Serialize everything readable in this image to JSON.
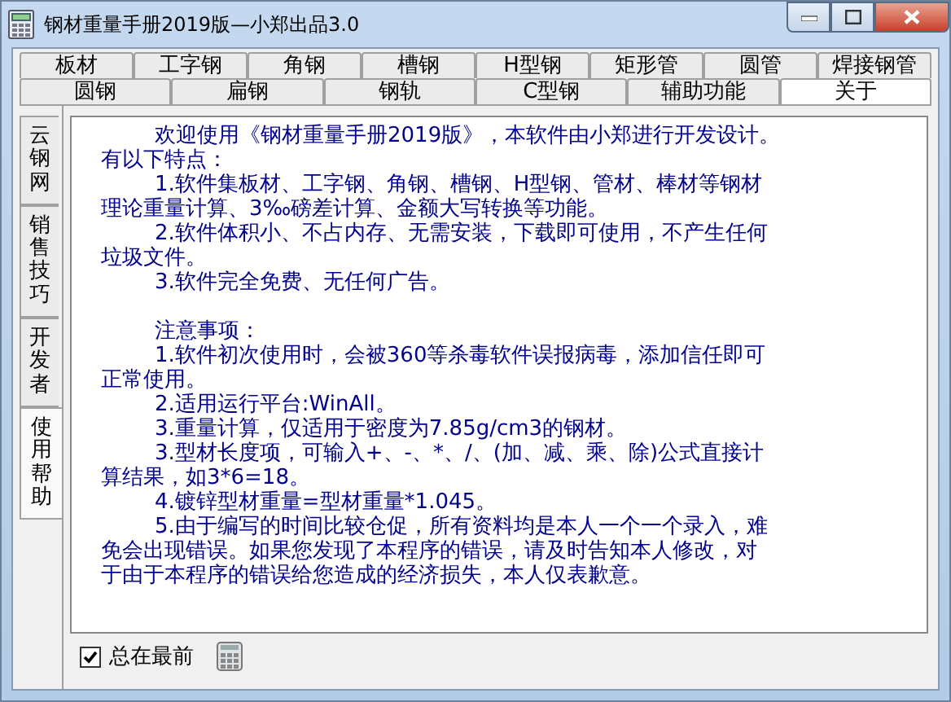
{
  "window": {
    "title": "钢材重量手册2019版—小郑出品3.0"
  },
  "tab_rows": [
    [
      {
        "label": "板材",
        "selected": false
      },
      {
        "label": "工字钢",
        "selected": false
      },
      {
        "label": "角钢",
        "selected": false
      },
      {
        "label": "槽钢",
        "selected": false
      },
      {
        "label": "H型钢",
        "selected": false
      },
      {
        "label": "矩形管",
        "selected": false
      },
      {
        "label": "圆管",
        "selected": false
      },
      {
        "label": "焊接钢管",
        "selected": false
      }
    ],
    [
      {
        "label": "圆钢",
        "selected": false
      },
      {
        "label": "扁钢",
        "selected": false
      },
      {
        "label": "钢轨",
        "selected": false
      },
      {
        "label": "C型钢",
        "selected": false
      },
      {
        "label": "辅助功能",
        "selected": false
      },
      {
        "label": "关于",
        "selected": true
      }
    ]
  ],
  "side_tabs": [
    {
      "label": "云钢网",
      "selected": false
    },
    {
      "label": "销售技巧",
      "selected": false
    },
    {
      "label": "开发者",
      "selected": false
    },
    {
      "label": "使用帮助",
      "selected": true
    }
  ],
  "sections": [
    {
      "paragraphs": [
        {
          "lines": [
            "欢迎使用《钢材重量手册2019版》，本软件由小郑进行开发设计。",
            "有以下特点："
          ]
        },
        {
          "lines": [
            "1.软件集板材、工字钢、角钢、槽钢、H型钢、管材、棒材等钢材",
            "理论重量计算、3‰磅差计算、金额大写转换等功能。"
          ]
        },
        {
          "lines": [
            "2.软件体积小、不占内存、无需安装，下载即可使用，不产生任何",
            "垃圾文件。"
          ]
        },
        {
          "lines": [
            "3.软件完全免费、无任何广告。"
          ]
        }
      ]
    },
    {
      "paragraphs": [
        {
          "lines": [
            "注意事项："
          ]
        },
        {
          "lines": [
            "1.软件初次使用时，会被360等杀毒软件误报病毒，添加信任即可",
            "正常使用。"
          ]
        },
        {
          "lines": [
            "2.适用运行平台:WinAll。"
          ]
        },
        {
          "lines": [
            "3.重量计算，仅适用于密度为7.85g/cm3的钢材。"
          ]
        },
        {
          "lines": [
            "3.型材长度项，可输入+、-、*、/、(加、减、乘、除)公式直接计",
            "算结果，如3*6=18。"
          ]
        },
        {
          "lines": [
            "4.镀锌型材重量=型材重量*1.045。"
          ]
        },
        {
          "lines": [
            "5.由于编写的时间比较仓促，所有资料均是本人一个一个录入，难",
            "免会出现错误。如果您发现了本程序的错误，请及时告知本人修改，对",
            "于由于本程序的错误给您造成的经济损失，本人仅表歉意。"
          ]
        }
      ]
    }
  ],
  "always_on_top": {
    "label": "总在最前",
    "checked": true
  }
}
